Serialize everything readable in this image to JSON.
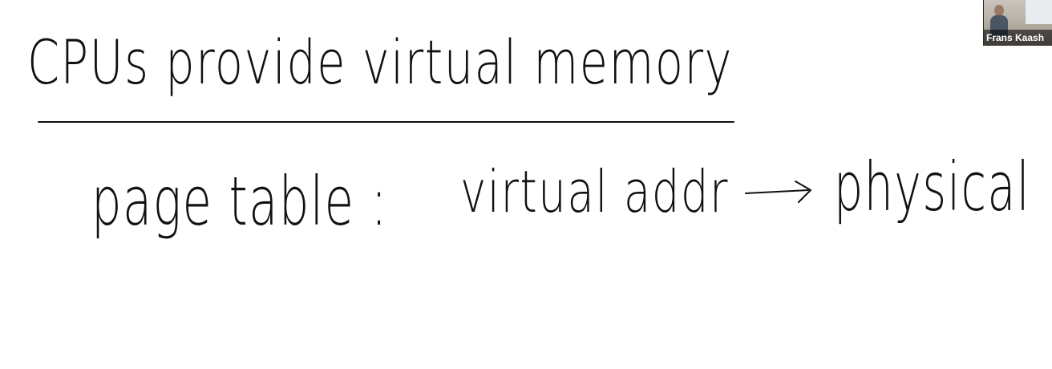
{
  "whiteboard": {
    "heading": "CPUs provide virtual memory",
    "line1": "page table :",
    "line2": "virtual addr",
    "arrow": "→",
    "line3": "physical"
  },
  "video_tile": {
    "participant_name": "Frans Kaash"
  },
  "colors": {
    "background": "#ffffff",
    "ink": "#111111"
  }
}
